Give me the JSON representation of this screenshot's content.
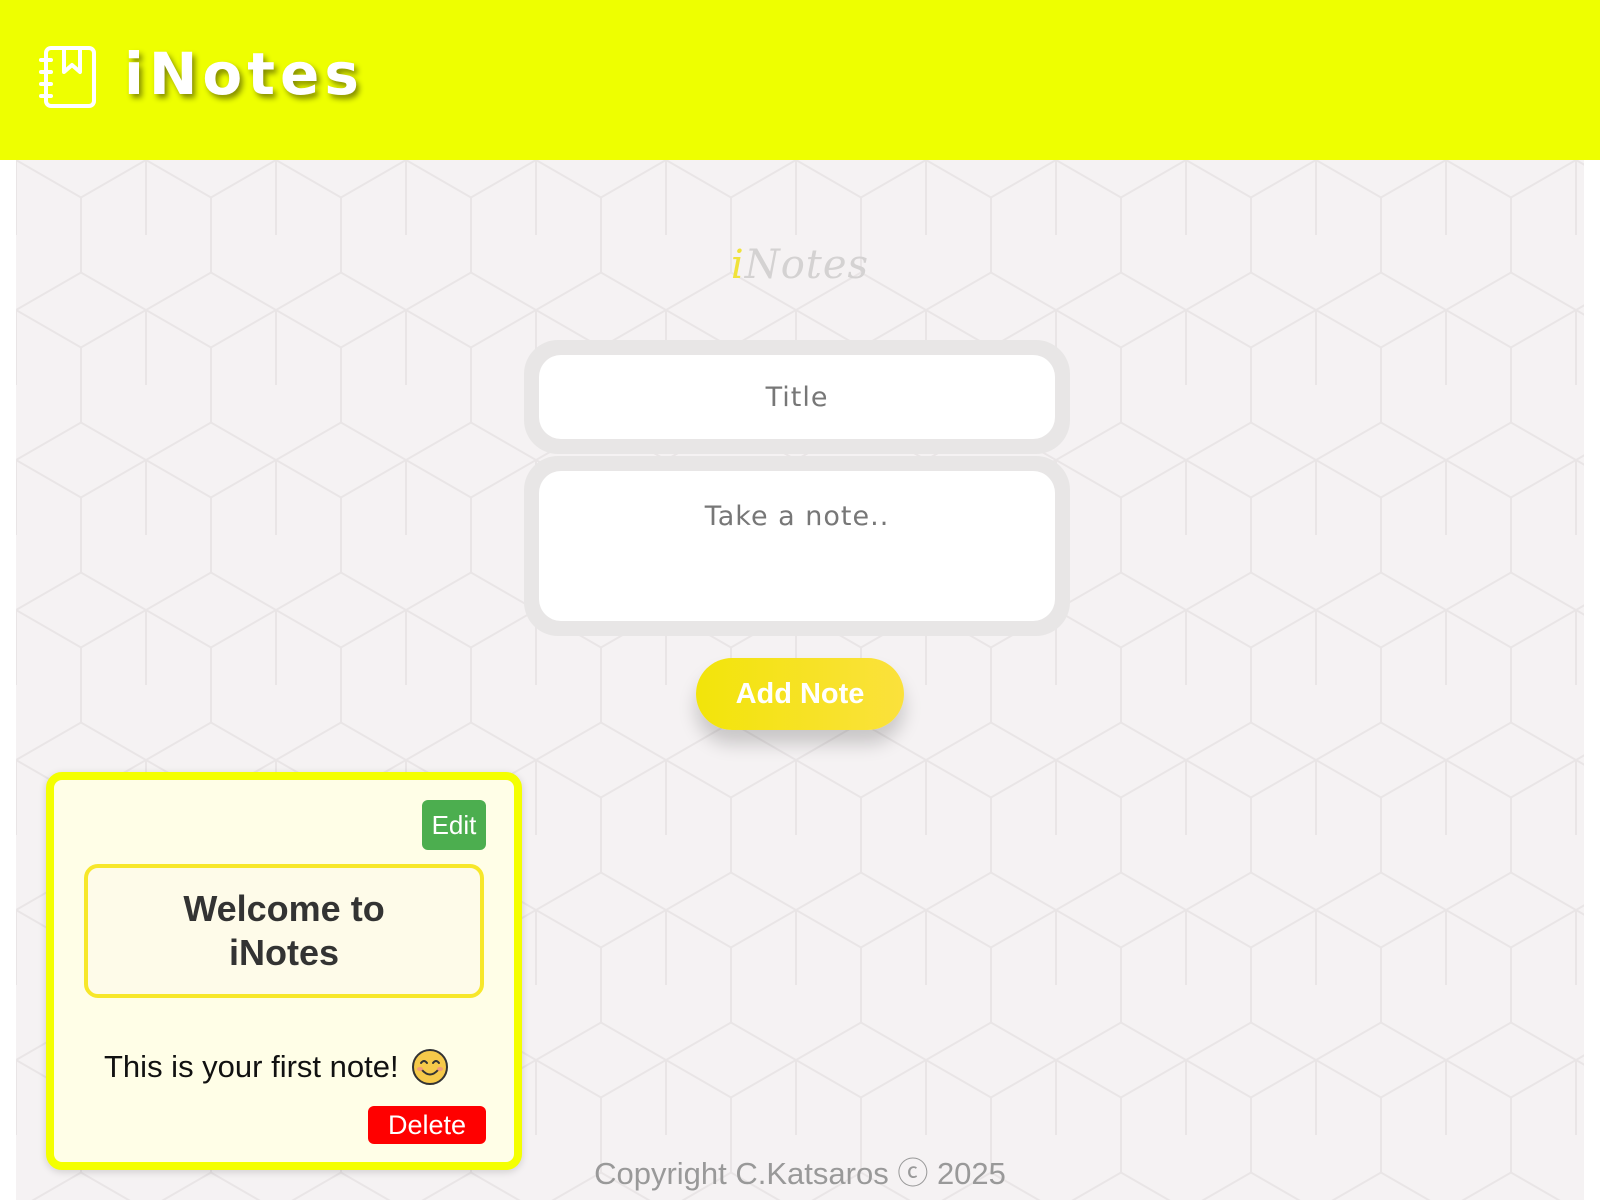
{
  "header": {
    "brand": "iNotes",
    "icon": "notebook-bookmark-icon",
    "background_color": "#eeff00"
  },
  "form": {
    "heading_first": "i",
    "heading_rest": "Notes",
    "title_placeholder": "Title",
    "note_placeholder": "Take a note..",
    "add_button_label": "Add Note"
  },
  "notes": [
    {
      "edit_label": "Edit",
      "title": "Welcome to iNotes",
      "body": "This is your first note!",
      "emoji_icon": "smiling-face-icon",
      "delete_label": "Delete"
    }
  ],
  "footer": {
    "copyright": "Copyright C.Katsaros ⓒ 2025"
  },
  "colors": {
    "accent_yellow": "#eeff00",
    "edit_green": "#4cae4f",
    "delete_red": "#ff0000"
  }
}
